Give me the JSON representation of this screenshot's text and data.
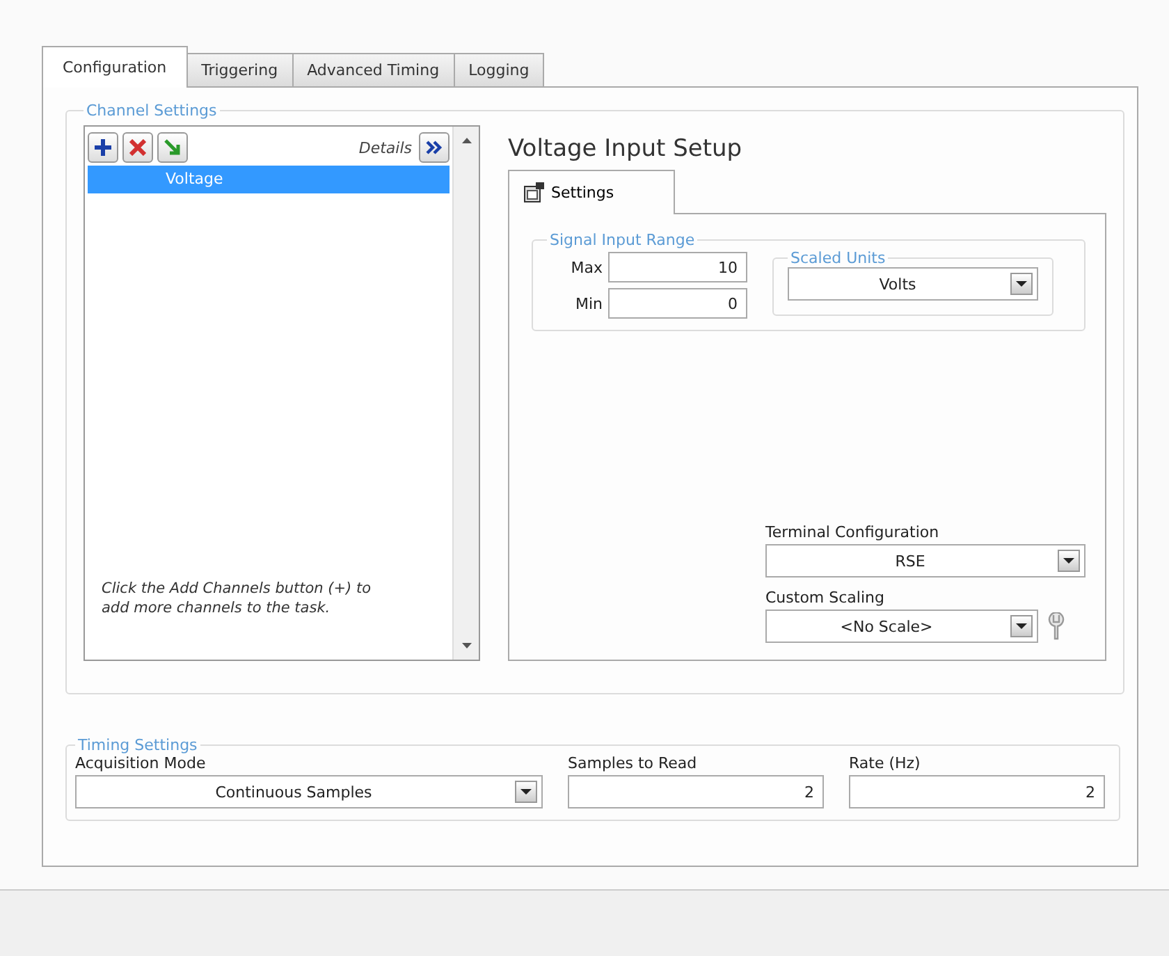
{
  "tabs": [
    {
      "label": "Configuration",
      "selected": true
    },
    {
      "label": "Triggering",
      "selected": false
    },
    {
      "label": "Advanced Timing",
      "selected": false
    },
    {
      "label": "Logging",
      "selected": false
    }
  ],
  "channel_settings": {
    "title": "Channel Settings",
    "details_label": "Details",
    "channels": [
      {
        "name": "Voltage",
        "selected": true
      }
    ],
    "hint": "Click the Add Channels button (+) to add more channels to the task."
  },
  "setup": {
    "title": "Voltage Input Setup",
    "tabs": [
      {
        "label": "Settings",
        "selected": true
      }
    ],
    "signal_input_range": {
      "title": "Signal Input Range",
      "max_label": "Max",
      "max": "10",
      "min_label": "Min",
      "min": "0"
    },
    "scaled_units": {
      "title": "Scaled Units",
      "value": "Volts"
    },
    "terminal_configuration": {
      "label": "Terminal Configuration",
      "value": "RSE"
    },
    "custom_scaling": {
      "label": "Custom Scaling",
      "value": "<No Scale>"
    }
  },
  "timing_settings": {
    "title": "Timing Settings",
    "acquisition_mode": {
      "label": "Acquisition Mode",
      "value": "Continuous Samples"
    },
    "samples_to_read": {
      "label": "Samples to Read",
      "value": "2"
    },
    "rate": {
      "label": "Rate (Hz)",
      "value": "2"
    }
  }
}
